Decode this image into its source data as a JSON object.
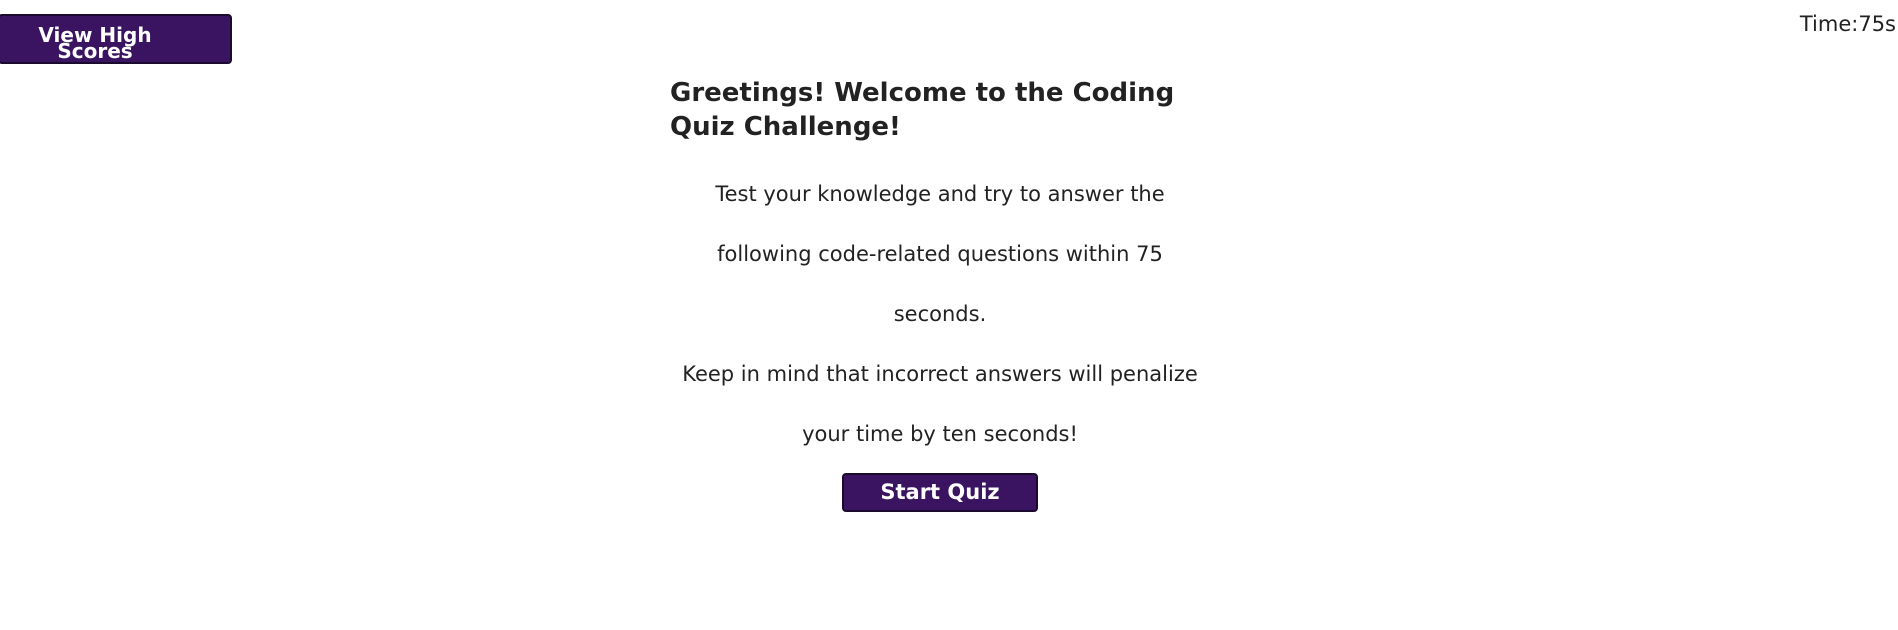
{
  "header": {
    "high_scores_label": "View High Scores",
    "timer_label": "Time:",
    "timer_value": "75s"
  },
  "intro": {
    "title": "Greetings! Welcome to the Coding Quiz Challenge!",
    "description": "Test your knowledge and try to answer the following code-related questions within 75 seconds.",
    "warning": "Keep in mind that incorrect answers will penalize your time by ten seconds!"
  },
  "start_button": {
    "label": "Start Quiz"
  },
  "colors": {
    "button_background": "#3a1460",
    "button_text": "#ffffff",
    "body_text": "#222222"
  }
}
